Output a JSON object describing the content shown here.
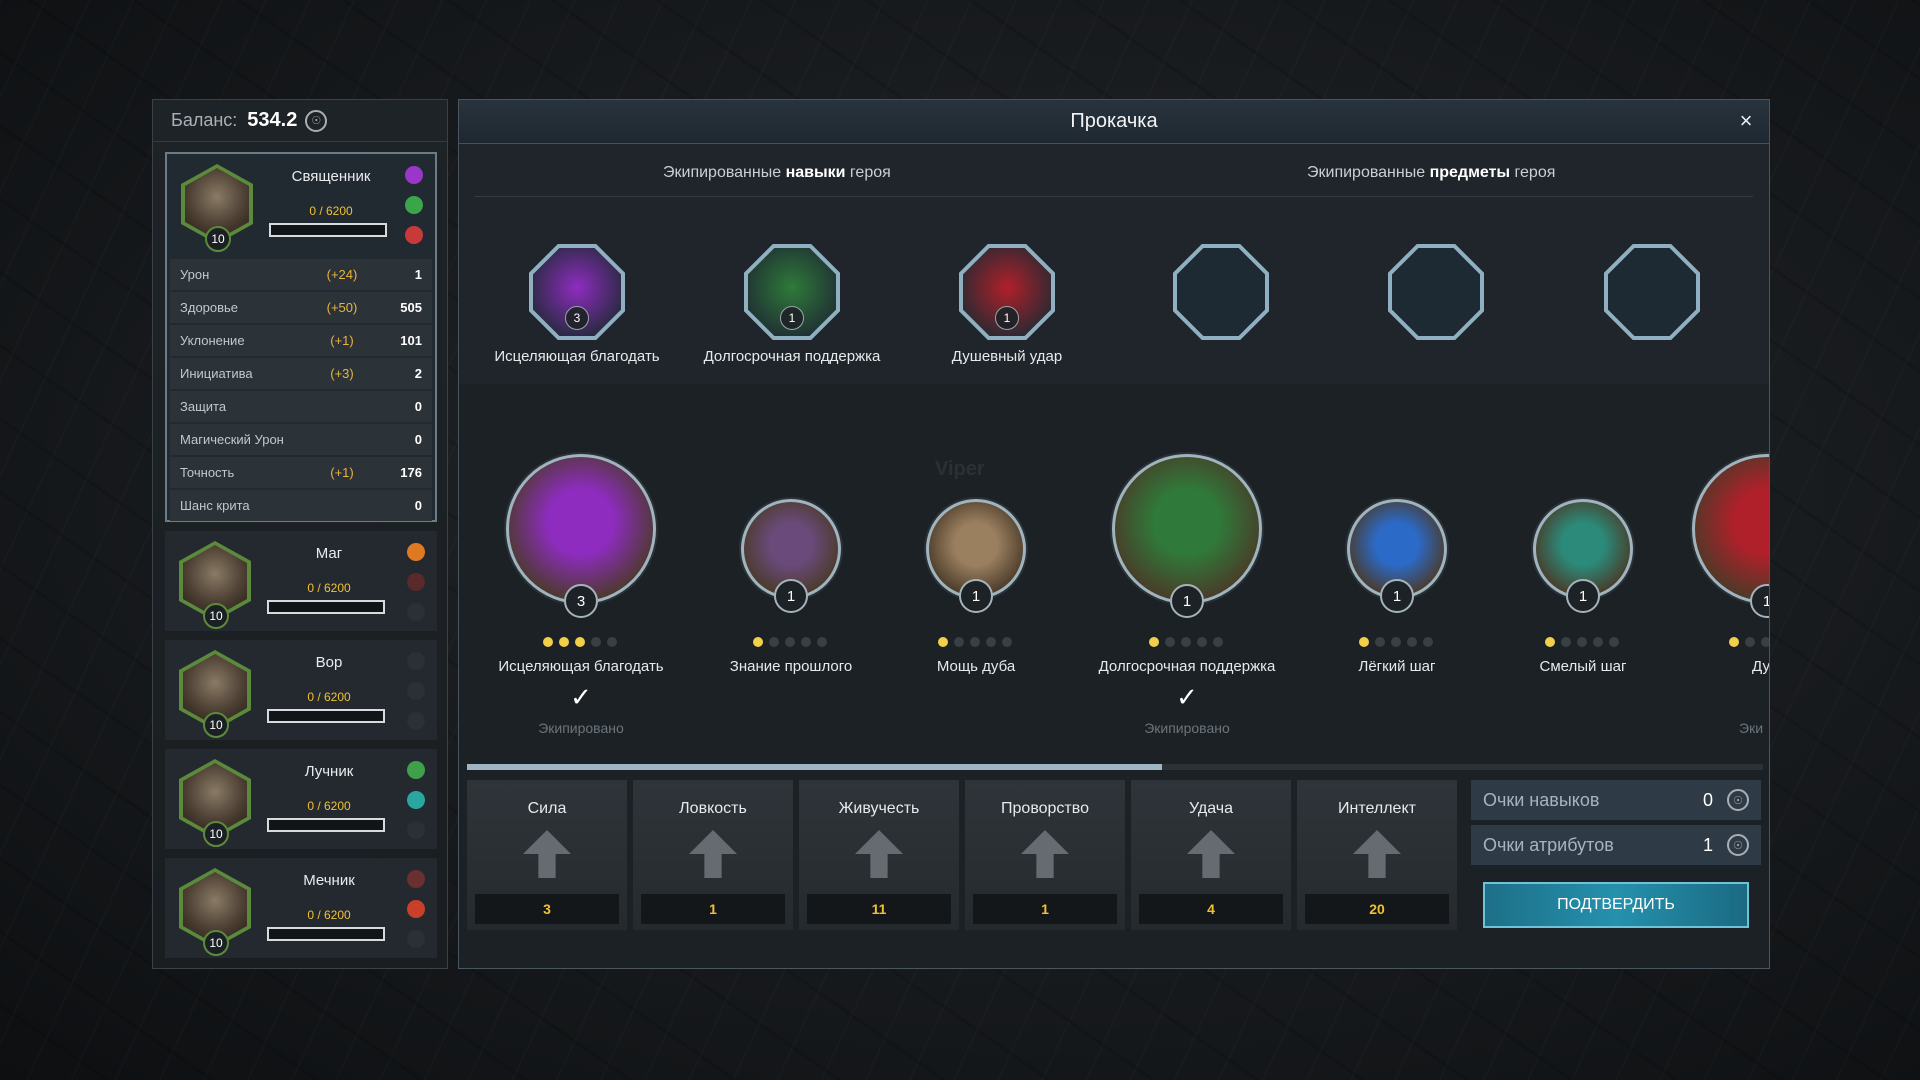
{
  "balance": {
    "label": "Баланс:",
    "value": "534.2"
  },
  "heroes": [
    {
      "name": "Священник",
      "xp": "0 / 6200",
      "level": "10",
      "active": true,
      "portrait_color": "#6b5b4a",
      "orbs": [
        "#9b37c8",
        "#3aa64a",
        "#c83a3a"
      ],
      "stats": [
        {
          "name": "Урон",
          "bonus": "(+24)",
          "value": "1"
        },
        {
          "name": "Здоровье",
          "bonus": "(+50)",
          "value": "505"
        },
        {
          "name": "Уклонение",
          "bonus": "(+1)",
          "value": "101"
        },
        {
          "name": "Инициатива",
          "bonus": "(+3)",
          "value": "2"
        },
        {
          "name": "Защита",
          "bonus": "",
          "value": "0"
        },
        {
          "name": "Магический Урон",
          "bonus": "",
          "value": "0"
        },
        {
          "name": "Точность",
          "bonus": "(+1)",
          "value": "176"
        },
        {
          "name": "Шанс крита",
          "bonus": "",
          "value": "0"
        }
      ]
    },
    {
      "name": "Маг",
      "xp": "0 / 6200",
      "level": "10",
      "orbs": [
        "#e07a22",
        "#5a2a2a"
      ]
    },
    {
      "name": "Вор",
      "xp": "0 / 6200",
      "level": "10",
      "orbs": []
    },
    {
      "name": "Лучник",
      "xp": "0 / 6200",
      "level": "10",
      "orbs": [
        "#3fa04a",
        "#2aa6a0"
      ]
    },
    {
      "name": "Мечник",
      "xp": "0 / 6200",
      "level": "10",
      "orbs": [
        "#6a3030",
        "#c8402a"
      ]
    }
  ],
  "dialog": {
    "title": "Прокачка",
    "close": "×",
    "equipped_skills_header": {
      "prefix": "Экипированные ",
      "bold": "навыки",
      "suffix": " героя"
    },
    "equipped_items_header": {
      "prefix": "Экипированные ",
      "bold": "предметы",
      "suffix": " героя"
    },
    "equipped_skills": [
      {
        "name": "Исцеляющая благодать",
        "level": "3",
        "color": "#8e2cc0"
      },
      {
        "name": "Долгосрочная поддержка",
        "level": "1",
        "color": "#2f7a3a"
      },
      {
        "name": "Душевный удар",
        "level": "1",
        "color": "#b0202a"
      }
    ],
    "equipped_items": [
      {},
      {},
      {}
    ],
    "watermark": "Viper",
    "skills": [
      {
        "name": "Исцеляющая благодать",
        "level": "3",
        "dots": 3,
        "equipped": true,
        "color": "#8e2cc0",
        "big": true
      },
      {
        "name": "Знание прошлого",
        "level": "1",
        "dots": 1,
        "equipped": false,
        "color": "#6a4a7a"
      },
      {
        "name": "Мощь дуба",
        "level": "1",
        "dots": 1,
        "equipped": false,
        "color": "#9b8060"
      },
      {
        "name": "Долгосрочная поддержка",
        "level": "1",
        "dots": 1,
        "equipped": true,
        "color": "#2f7a3a",
        "big": true
      },
      {
        "name": "Лёгкий шаг",
        "level": "1",
        "dots": 1,
        "equipped": false,
        "color": "#2c6ac8"
      },
      {
        "name": "Смелый шаг",
        "level": "1",
        "dots": 1,
        "equipped": false,
        "color": "#2c8a7a"
      },
      {
        "name": "Душ",
        "level": "1",
        "dots": 1,
        "equipped": false,
        "color": "#b0202a",
        "big": true
      }
    ],
    "equipped_text": "Экипировано",
    "equipped_text_partial": "Эки",
    "attributes": [
      {
        "name": "Сила",
        "value": "3"
      },
      {
        "name": "Ловкость",
        "value": "1"
      },
      {
        "name": "Живучесть",
        "value": "11"
      },
      {
        "name": "Проворство",
        "value": "1"
      },
      {
        "name": "Удача",
        "value": "4"
      },
      {
        "name": "Интеллект",
        "value": "20"
      }
    ],
    "skill_points": {
      "label": "Очки навыков",
      "value": "0"
    },
    "attr_points": {
      "label": "Очки атрибутов",
      "value": "1"
    },
    "confirm": "ПОДТВЕРДИТЬ"
  }
}
